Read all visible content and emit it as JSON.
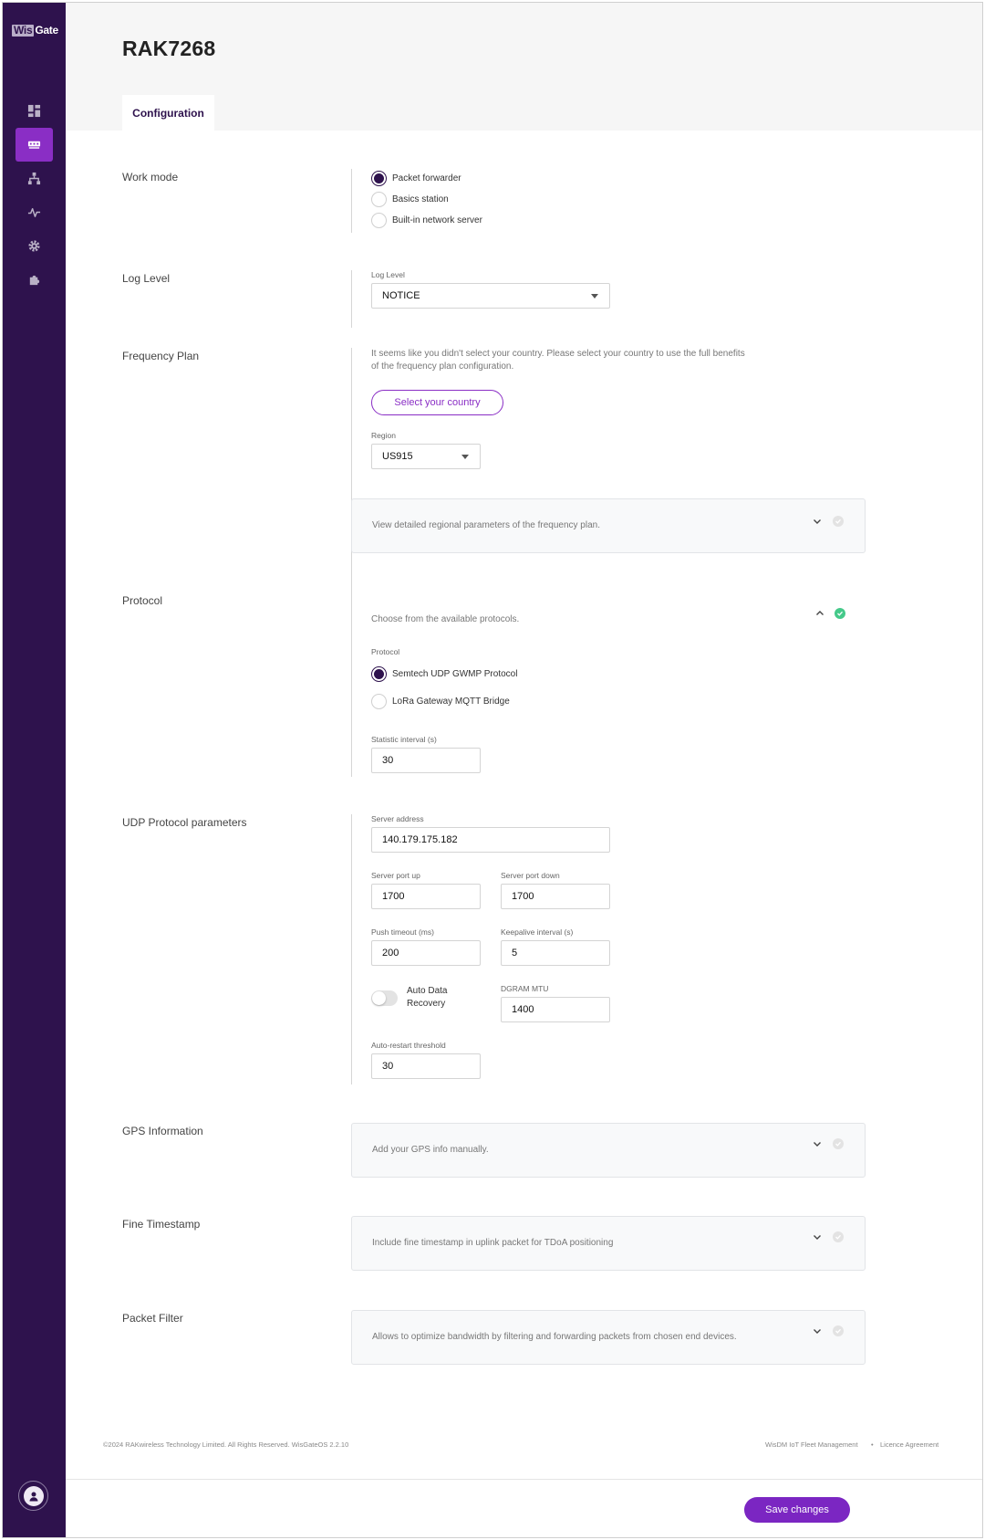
{
  "app": {
    "logo_prefix": "Wis",
    "logo_suffix": "Gate"
  },
  "sidebar": {
    "items": [
      {
        "icon": "dashboard-icon",
        "active": false
      },
      {
        "icon": "gateway-icon",
        "active": true
      },
      {
        "icon": "network-icon",
        "active": false
      },
      {
        "icon": "activity-icon",
        "active": false
      },
      {
        "icon": "gear-icon",
        "active": false
      },
      {
        "icon": "puzzle-icon",
        "active": false
      }
    ],
    "user_icon": "user-icon"
  },
  "header": {
    "title": "RAK7268",
    "tab": "Configuration"
  },
  "work_mode": {
    "label": "Work mode",
    "options": [
      "Packet forwarder",
      "Basics station",
      "Built-in network server"
    ],
    "selected": "Packet forwarder"
  },
  "log_level": {
    "label": "Log Level",
    "field_label": "Log Level",
    "value": "NOTICE"
  },
  "frequency_plan": {
    "label": "Frequency Plan",
    "hint_line1": "It seems like you didn't select your country. Please select your country to use the full benefits",
    "hint_line2": "of the frequency plan configuration.",
    "select_country": "Select your country",
    "region_label": "Region",
    "region_value": "US915",
    "panel_text": "View detailed regional parameters of the frequency plan."
  },
  "protocol": {
    "label": "Protocol",
    "hint": "Choose from the available protocols.",
    "field_label": "Protocol",
    "options": [
      "Semtech UDP GWMP Protocol",
      "LoRa Gateway MQTT Bridge"
    ],
    "selected": "Semtech UDP GWMP Protocol",
    "stat_label": "Statistic interval (s)",
    "stat_value": "30"
  },
  "udp": {
    "label": "UDP Protocol parameters",
    "server_address_label": "Server address",
    "server_address": "140.179.175.182",
    "port_up_label": "Server port up",
    "port_up": "1700",
    "port_down_label": "Server port down",
    "port_down": "1700",
    "push_timeout_label": "Push timeout (ms)",
    "push_timeout": "200",
    "keepalive_label": "Keepalive interval (s)",
    "keepalive": "5",
    "auto_recovery_line1": "Auto Data",
    "auto_recovery_line2": "Recovery",
    "auto_recovery_on": false,
    "mtu_label": "DGRAM MTU",
    "mtu": "1400",
    "restart_label": "Auto-restart threshold",
    "restart": "30"
  },
  "gps": {
    "label": "GPS Information",
    "panel_text": "Add your GPS info manually."
  },
  "fine_timestamp": {
    "label": "Fine Timestamp",
    "panel_text": "Include fine timestamp in uplink packet for TDoA positioning"
  },
  "packet_filter": {
    "label": "Packet Filter",
    "panel_text": "Allows to optimize bandwidth by filtering and forwarding packets from chosen end devices."
  },
  "footer": {
    "copyright": "©2024 RAKwireless Technology Limited. All Rights Reserved. WisGateOS 2.2.10",
    "link1": "WisDM IoT Fleet Management",
    "separator": "•",
    "link2": "Licence Agreement",
    "save": "Save changes"
  }
}
